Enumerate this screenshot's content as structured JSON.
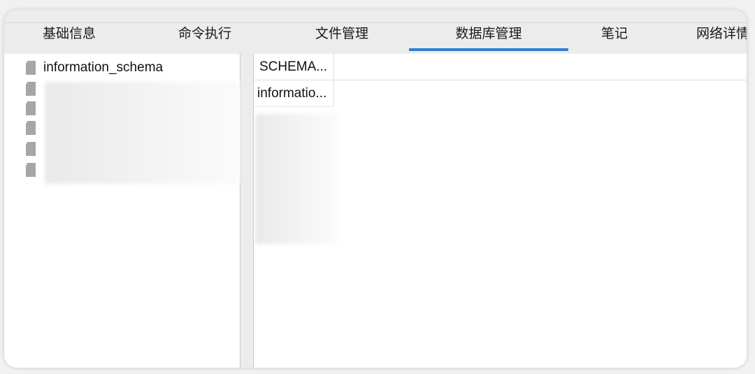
{
  "tabs": [
    {
      "label": "基础信息",
      "active": false
    },
    {
      "label": "命令执行",
      "active": false
    },
    {
      "label": "文件管理",
      "active": false
    },
    {
      "label": "数据库管理",
      "active": true
    },
    {
      "label": "笔记",
      "active": false
    },
    {
      "label": "网络详情",
      "active": false
    }
  ],
  "accent_color": "#2f80d1",
  "tree": {
    "items": [
      {
        "label": "information_schema",
        "icon": "database-file-icon",
        "redacted": false
      },
      {
        "label": "",
        "icon": "database-file-icon",
        "redacted": true
      },
      {
        "label": "",
        "icon": "database-file-icon",
        "redacted": true
      },
      {
        "label": "",
        "icon": "database-file-icon",
        "redacted": true
      },
      {
        "label": "",
        "icon": "database-file-icon",
        "redacted": true
      },
      {
        "label": "",
        "icon": "database-file-icon",
        "redacted": true
      }
    ]
  },
  "grid": {
    "column_header": "SCHEMA...",
    "rows": [
      {
        "value": "informatio..."
      }
    ]
  }
}
